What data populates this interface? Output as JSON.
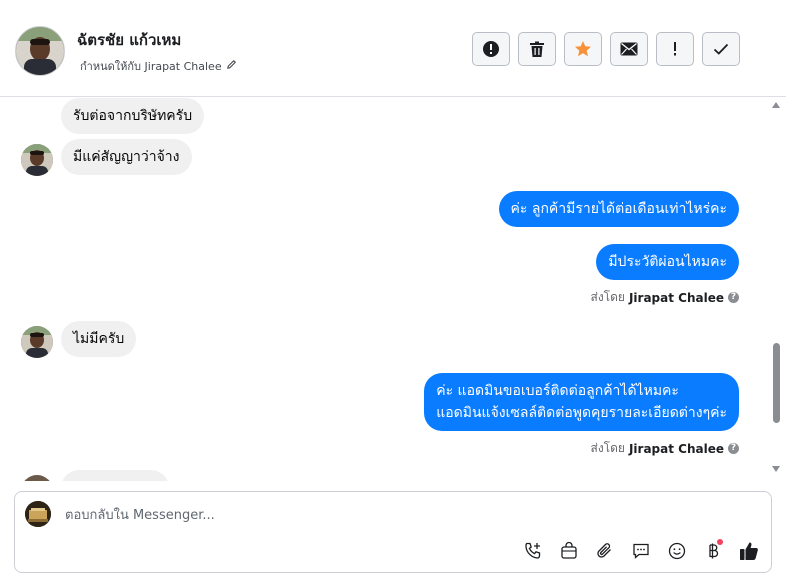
{
  "header": {
    "contact_name": "ฉัตรชัย แก้วเหม",
    "assigned_label": "กำหนดให้กับ Jirapat Chalee",
    "toolbar": [
      "mark-spam",
      "delete",
      "star",
      "mark-unread",
      "follow-up",
      "done"
    ]
  },
  "messages": [
    {
      "side": "in",
      "text": "รับต่อจากบริษัทครับ"
    },
    {
      "side": "in",
      "text": "มีแค่สัญญาว่าจ้าง"
    },
    {
      "side": "out",
      "text": "ค่ะ ลูกค้ามีรายได้ต่อเดือนเท่าไหร่คะ"
    },
    {
      "side": "out",
      "text": "มีประวัติผ่อนไหมคะ"
    },
    {
      "side": "in",
      "text": "ไม่มีครับ"
    },
    {
      "side": "out",
      "line1": "ค่ะ แอดมินขอเบอร์ติดต่อลูกค้าได้ไหมคะ",
      "line2": "แอดมินแจ้งเซลล์ติดต่อพูดคุยรายละเอียดต่างๆค่ะ"
    }
  ],
  "sent_by": {
    "prefix": "ส่งโดย",
    "name": "Jirapat Chalee"
  },
  "composer": {
    "placeholder": "ตอบกลับใน Messenger..."
  },
  "colors": {
    "outgoing_bubble": "#0a7cff",
    "incoming_bubble": "#f0f0f0",
    "star": "#f7923b",
    "notification_dot": "#f3425f"
  }
}
